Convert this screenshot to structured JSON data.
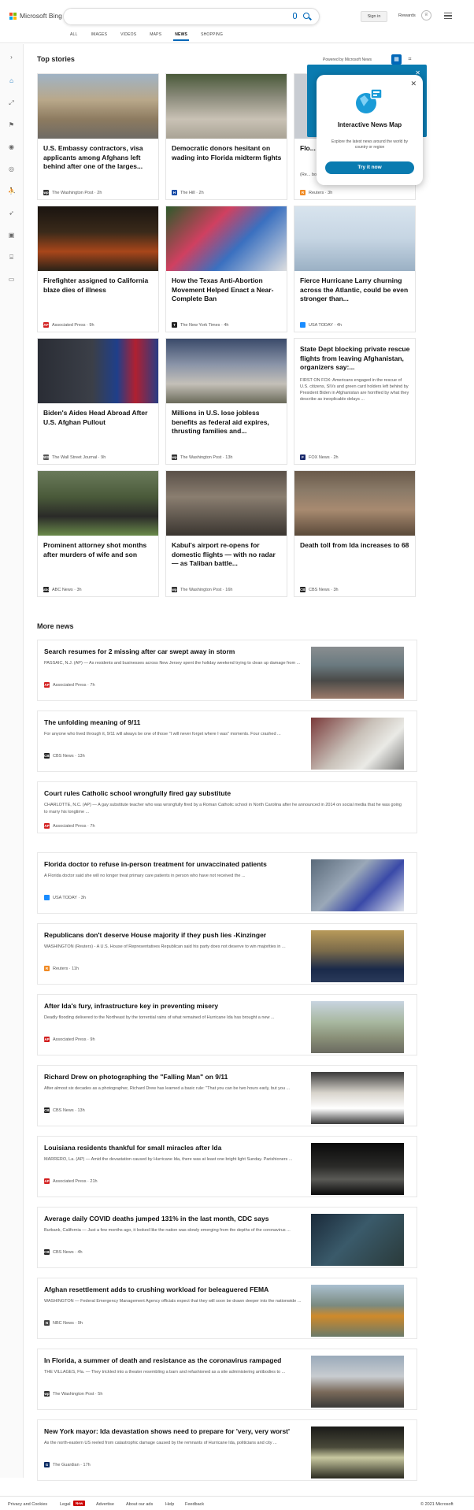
{
  "header": {
    "brand": "Microsoft Bing",
    "signin": "Sign in",
    "rewards": "Rewards",
    "tabs": [
      "ALL",
      "IMAGES",
      "VIDEOS",
      "MAPS",
      "NEWS",
      "SHOPPING"
    ],
    "active_tab": "NEWS"
  },
  "top_stories": {
    "heading": "Top stories",
    "powered": "Powered by Microsoft News",
    "cards": [
      {
        "title": "U.S. Embassy contractors, visa applicants among Afghans left behind after one of the larges...",
        "source": "The Washington Post",
        "time": "2h",
        "logo": "wp",
        "logo_color": "#333333"
      },
      {
        "title": "Democratic donors hesitant on wading into Florida midterm fights",
        "source": "The Hill",
        "time": "2h",
        "logo": "H",
        "logo_color": "#1a4da8"
      },
      {
        "title": "Flo... inc... yea...",
        "snippet": "(Re... body a... includi... baby b... police",
        "source": "Reuters",
        "time": "3h",
        "logo": "R",
        "logo_color": "#f08a24"
      },
      {
        "title": "Firefighter assigned to California blaze dies of illness",
        "source": "Associated Press",
        "time": "9h",
        "logo": "AP",
        "logo_color": "#d32020"
      },
      {
        "title": "How the Texas Anti-Abortion Movement Helped Enact a Near-Complete Ban",
        "source": "The New York Times",
        "time": "4h",
        "logo": "T",
        "logo_color": "#222222"
      },
      {
        "title": "Fierce Hurricane Larry churning across the Atlantic, could be even stronger than...",
        "source": "USA TODAY",
        "time": "4h",
        "logo": "",
        "logo_color": "#1a8cff"
      },
      {
        "title": "Biden's Aides Head Abroad After U.S. Afghan Pullout",
        "source": "The Wall Street Journal",
        "time": "9h",
        "logo": "WSJ",
        "logo_color": "#555555"
      },
      {
        "title": "Millions in U.S. lose jobless benefits as federal aid expires, thrusting families and...",
        "source": "The Washington Post",
        "time": "13h",
        "logo": "wp",
        "logo_color": "#333333"
      },
      {
        "title": "State Dept blocking private rescue flights from leaving Afghanistan, organizers say:...",
        "snippet": "FIRST ON FOX: Americans engaged in the rescue of U.S. citizens, SIVs and green card holders left behind by President Biden in Afghanistan are horrified by what they describe as inexplicable delays ...",
        "source": "FOX News",
        "time": "2h",
        "logo": "F",
        "logo_color": "#1a2a6c"
      },
      {
        "title": "Prominent attorney shot months after murders of wife and son",
        "source": "ABC News",
        "time": "3h",
        "logo": "abc",
        "logo_color": "#222222"
      },
      {
        "title": "Kabul's airport re-opens for domestic flights — with no radar — as Taliban battle...",
        "source": "The Washington Post",
        "time": "16h",
        "logo": "wp",
        "logo_color": "#333333"
      },
      {
        "title": "Death toll from Ida increases to 68",
        "source": "CBS News",
        "time": "3h",
        "logo": "CBS",
        "logo_color": "#222222"
      }
    ]
  },
  "popup": {
    "title": "Interactive News Map",
    "desc": "Explore the latest news around the world by country or region",
    "button": "Try it now",
    "bg_text": "es",
    "bg_button": "w"
  },
  "more_news": {
    "heading": "More news",
    "items": [
      {
        "title": "Search resumes for 2 missing after car swept away in storm",
        "snippet": "PASSAIC, N.J. (AP) — As residents and businesses across New Jersey spent the holiday weekend trying to clean up damage from ...",
        "source": "Associated Press",
        "time": "7h",
        "logo": "AP",
        "logo_color": "#d32020"
      },
      {
        "title": "The unfolding meaning of 9/11",
        "snippet": "For anyone who lived through it, 9/11 will always be one of those \"I will never forget where I was\" moments. Four crashed ...",
        "source": "CBS News",
        "time": "13h",
        "logo": "CBS",
        "logo_color": "#222222"
      },
      {
        "title": "Court rules Catholic school wrongfully fired gay substitute",
        "snippet": "CHARLOTTE, N.C. (AP) — A gay substitute teacher who was wrongfully fired by a Roman Catholic school in North Carolina after he announced in 2014 on social media that he was going to marry his longtime ...",
        "source": "Associated Press",
        "time": "7h",
        "logo": "AP",
        "logo_color": "#d32020"
      },
      {
        "title": "Florida doctor to refuse in-person treatment for unvaccinated patients",
        "snippet": "A Florida doctor said she will no longer treat primary care patients in person who have not received the ...",
        "source": "USA TODAY",
        "time": "3h",
        "logo": "",
        "logo_color": "#1a8cff"
      },
      {
        "title": "Republicans don't deserve House majority if they push lies -Kinzinger",
        "snippet": "WASHINGTON (Reuters) - A U.S. House of Representatives Republican said his party does not deserve to win majorities in ...",
        "source": "Reuters",
        "time": "11h",
        "logo": "R",
        "logo_color": "#f08a24"
      },
      {
        "title": "After Ida's fury, infrastructure key in preventing misery",
        "snippet": "Deadly flooding delivered to the Northeast by the torrential rains of what remained of Hurricane Ida has brought a new ...",
        "source": "Associated Press",
        "time": "9h",
        "logo": "AP",
        "logo_color": "#d32020"
      },
      {
        "title": "Richard Drew on photographing the \"Falling Man\" on 9/11",
        "snippet": "After almost six decades as a photographer, Richard Drew has learned a basic rule: \"That you can be two hours early, but you ...",
        "source": "CBS News",
        "time": "13h",
        "logo": "CBS",
        "logo_color": "#222222"
      },
      {
        "title": "Louisiana residents thankful for small miracles after Ida",
        "snippet": "MARRERO, La. (AP) — Amid the devastation caused by Hurricane Ida, there was at least one bright light Sunday. Parishioners ...",
        "source": "Associated Press",
        "time": "21h",
        "logo": "AP",
        "logo_color": "#d32020"
      },
      {
        "title": "Average daily COVID deaths jumped 131% in the last month, CDC says",
        "snippet": "Burbank, California — Just a few months ago, it looked like the nation was slowly emerging from the depths of the coronavirus ...",
        "source": "CBS News",
        "time": "4h",
        "logo": "CBS",
        "logo_color": "#222222"
      },
      {
        "title": "Afghan resettlement adds to crushing workload for beleaguered FEMA",
        "snippet": "WASHINGTON — Federal Emergency Management Agency officials expect that they will soon be drawn deeper into the nationwide ...",
        "source": "NBC News",
        "time": "9h",
        "logo": "N",
        "logo_color": "#444444"
      },
      {
        "title": "In Florida, a summer of death and resistance as the coronavirus rampaged",
        "snippet": "THE VILLAGES, Fla. — They trickled into a theater resembling a barn and refashioned as a site administering antibodies to ...",
        "source": "The Washington Post",
        "time": "5h",
        "logo": "wp",
        "logo_color": "#333333"
      },
      {
        "title": "New York mayor: Ida devastation shows need to prepare for 'very, very worst'",
        "snippet": "As the north-eastern US reeled from catastrophic damage caused by the remnants of Hurricane Ida, politicians and city ...",
        "source": "The Guardian",
        "time": "17h",
        "logo": "G",
        "logo_color": "#052962"
      }
    ]
  },
  "footer": {
    "privacy": "Privacy and Cookies",
    "legal": "Legal",
    "new_badge": "New",
    "advertise": "Advertise",
    "about_ads": "About our ads",
    "help": "Help",
    "feedback": "Feedback",
    "copyright": "© 2021 Microsoft"
  },
  "colors": {
    "accent": "#0067b8",
    "popup": "#0a7bb0"
  },
  "icons": [
    "search-icon",
    "microphone-icon",
    "trophy-icon",
    "menu-icon",
    "expand-icon",
    "home-icon",
    "fullscreen-icon",
    "flag-icon",
    "location-icon",
    "globe-icon",
    "sports-icon",
    "rocket-icon",
    "tv-icon",
    "bank-icon",
    "card-icon",
    "grid-view-icon",
    "map-view-icon",
    "close-icon"
  ]
}
